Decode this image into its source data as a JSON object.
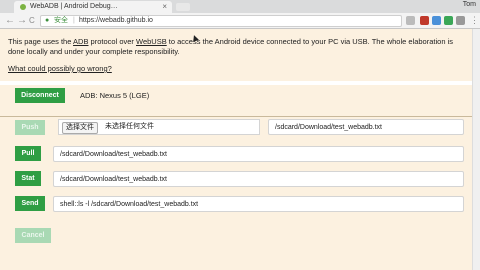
{
  "browser": {
    "tab_title": "WebADB | Android Debug…",
    "tab_close": "×",
    "user": "Tom",
    "secure_label": "安全",
    "url": "https://webadb.github.io",
    "back_glyph": "←",
    "forward_glyph": "→",
    "reload_glyph": "C",
    "lock_glyph": "🔒"
  },
  "info": {
    "text_prefix": "This page uses the ",
    "adb_link": "ADB",
    "text_middle": " protocol over ",
    "webusb_link": "WebUSB",
    "text_suffix": " to access the Android device connected to your PC via USB. The whole elaboration is done locally and under your complete responsibility.",
    "what_could_go_wrong": "What could possibly go wrong?"
  },
  "device": {
    "disconnect_label": "Disconnect",
    "status": "ADB: Nexus 5 (LGE)"
  },
  "actions": {
    "push_label": "Push",
    "choose_file_label": "选择文件",
    "no_file_label": "未选择任何文件",
    "push_path": "/sdcard/Download/test_webadb.txt",
    "pull_label": "Pull",
    "pull_path": "/sdcard/Download/test_webadb.txt",
    "stat_label": "Stat",
    "stat_path": "/sdcard/Download/test_webadb.txt",
    "send_label": "Send",
    "send_command": "shell::ls -l /sdcard/Download/test_webadb.txt",
    "cancel_label": "Cancel"
  },
  "colors": {
    "accent_green": "#2f9e44",
    "disabled_green": "#a9d9b4",
    "panel_bg": "#fcf1e0"
  }
}
